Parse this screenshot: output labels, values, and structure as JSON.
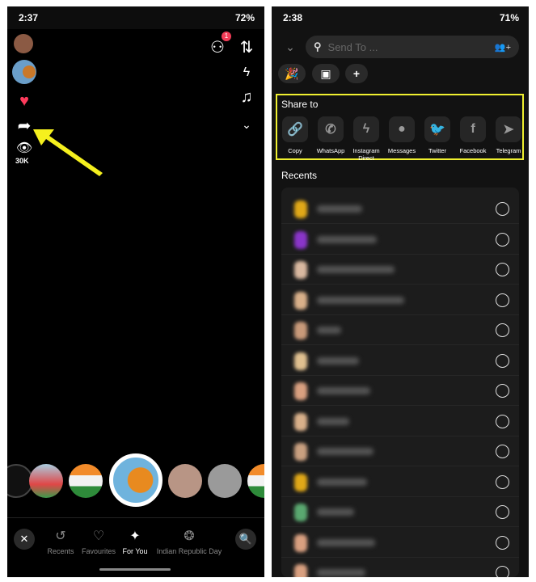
{
  "left": {
    "status": {
      "time": "2:37",
      "battery": "72%"
    },
    "views": "30K",
    "add_friend_badge": "1",
    "tabs": [
      {
        "label": "Recents",
        "icon": "history-icon"
      },
      {
        "label": "Favourites",
        "icon": "heart-outline-icon"
      },
      {
        "label": "For You",
        "icon": "sparkles-icon",
        "active": true
      },
      {
        "label": "Indian Republic Day",
        "icon": "ashoka-chakra-icon"
      }
    ],
    "annotation_color": "#f5f01e"
  },
  "right": {
    "status": {
      "time": "2:38",
      "battery": "71%"
    },
    "search_placeholder": "Send To ...",
    "share_title": "Share to",
    "share_apps": [
      {
        "label": "Copy",
        "glyph": "🔗"
      },
      {
        "label": "WhatsApp",
        "glyph": "✆"
      },
      {
        "label": "Instagram Direct",
        "glyph": "ϟ"
      },
      {
        "label": "Messages",
        "glyph": "●"
      },
      {
        "label": "Twitter",
        "glyph": "🐦"
      },
      {
        "label": "Facebook",
        "glyph": "f"
      },
      {
        "label": "Telegram",
        "glyph": "➤"
      }
    ],
    "recents_title": "Recents",
    "highlight_color": "#f0f030"
  }
}
